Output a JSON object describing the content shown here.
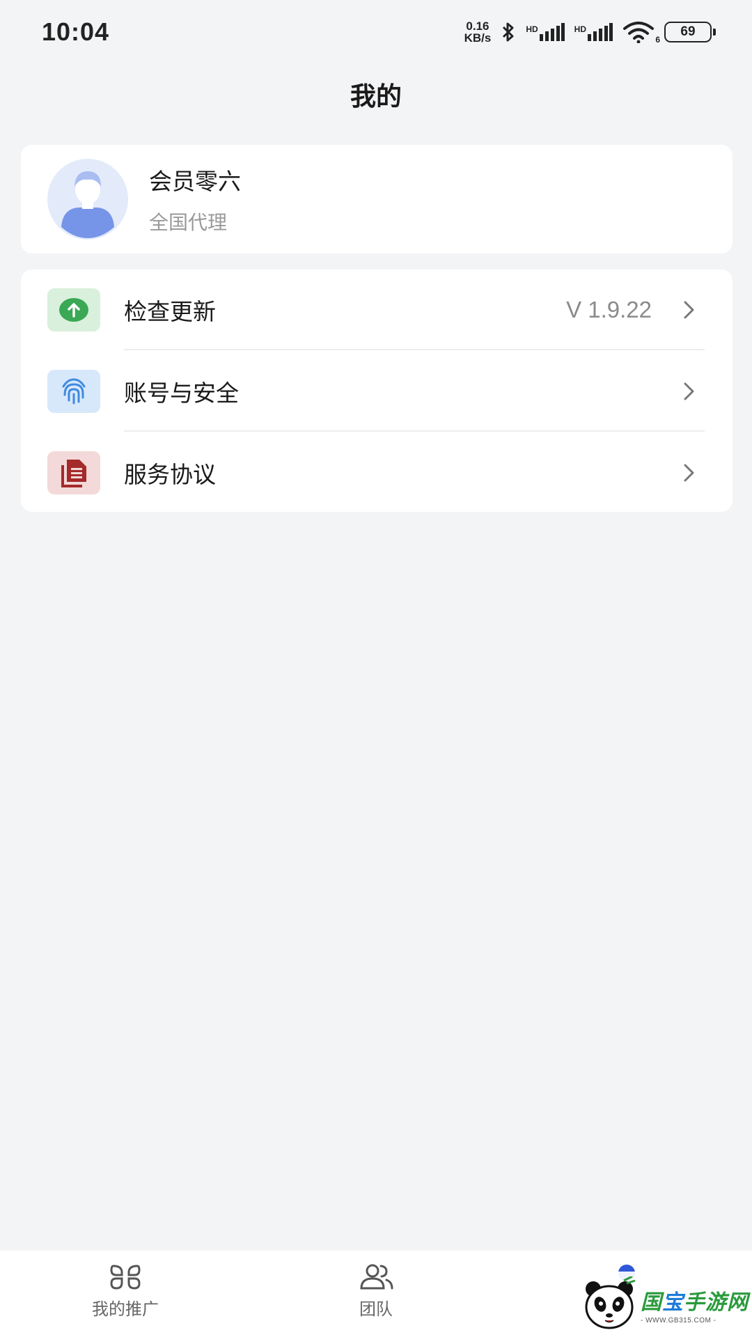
{
  "status_bar": {
    "time": "10:04",
    "net_speed_value": "0.16",
    "net_speed_unit": "KB/s",
    "hd_label_1": "HD",
    "hd_label_2": "HD",
    "wifi_badge": "6",
    "battery": "69"
  },
  "header": {
    "title": "我的"
  },
  "profile": {
    "name": "会员零六",
    "role": "全国代理"
  },
  "menu": {
    "items": [
      {
        "label": "检查更新",
        "value": "V 1.9.22",
        "icon": "upload-icon"
      },
      {
        "label": "账号与安全",
        "value": "",
        "icon": "fingerprint-icon"
      },
      {
        "label": "服务协议",
        "value": "",
        "icon": "document-icon"
      }
    ]
  },
  "bottom_nav": {
    "items": [
      {
        "label": "我的推广",
        "icon": "grid-icon"
      },
      {
        "label": "团队",
        "icon": "team-icon"
      },
      {
        "label": "",
        "icon": "profile-icon",
        "active": true
      }
    ]
  },
  "watermark": {
    "brand_1": "国",
    "brand_2": "宝",
    "brand_3": "手游网",
    "url": "- WWW.GB315.COM -"
  },
  "colors": {
    "background": "#f3f4f6",
    "accent": "#2e58d8",
    "update_icon": "#3aa854",
    "security_icon": "#3f8ae0",
    "agreement_icon": "#a52a2a"
  }
}
